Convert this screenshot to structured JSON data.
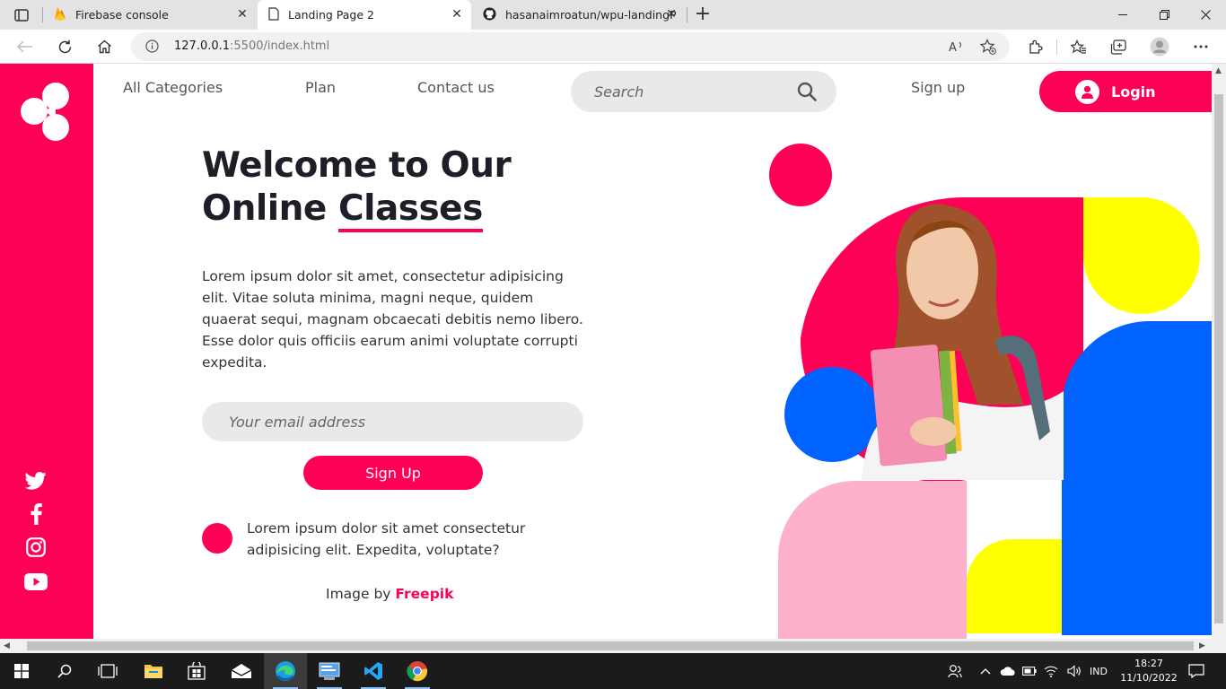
{
  "browser": {
    "tabs": [
      {
        "title": "Firebase console",
        "active": false
      },
      {
        "title": "Landing Page 2",
        "active": true
      },
      {
        "title": "hasanaimroatun/wpu-landingPage",
        "active": false
      }
    ],
    "close_glyph": "✕",
    "new_tab_glyph": "+",
    "url_host": "127.0.0.1",
    "url_rest": ":5500/index.html"
  },
  "page": {
    "nav": {
      "items": [
        "All Categories",
        "Plan",
        "Contact us"
      ],
      "search_placeholder": "Search",
      "signup": "Sign up",
      "login": "Login"
    },
    "hero": {
      "title_line1": "Welcome to Our",
      "title_line2_plain": "Online ",
      "title_line2_highlight": "Classes",
      "paragraph": "Lorem ipsum dolor sit amet, consectetur adipisicing elit. Vitae soluta minima, magni neque, quidem quaerat sequi, magnam obcaecati debitis nemo libero. Esse dolor quis officiis earum animi voluptate corrupti expedita.",
      "email_placeholder": "Your email address",
      "signup_button": "Sign Up",
      "bullet": "Lorem ipsum dolor sit amet consectetur adipisicing elit. Expedita, voluptate?",
      "credit_prefix": "Image by ",
      "credit_link": "Freepik"
    },
    "social_icons": [
      "twitter-icon",
      "facebook-icon",
      "instagram-icon",
      "youtube-icon"
    ]
  },
  "taskbar": {
    "lang": "IND",
    "time": "18:27",
    "date": "11/10/2022"
  },
  "colors": {
    "brand_pink": "#ff0057",
    "light_pink": "#ffb0cc",
    "yellow": "#ffff00",
    "blue": "#0062ff"
  }
}
